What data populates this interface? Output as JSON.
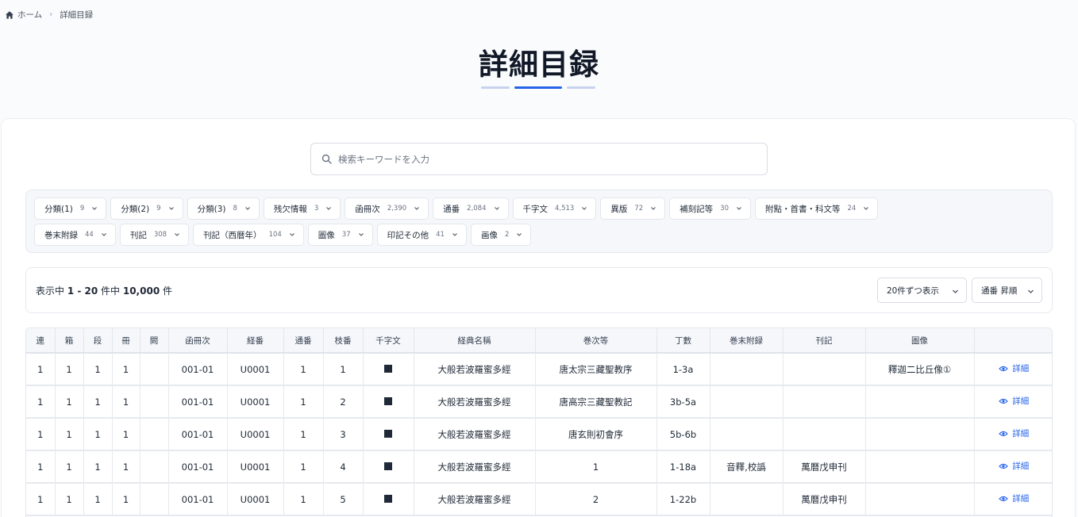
{
  "breadcrumb": {
    "home": "ホーム",
    "separator": "›",
    "current": "詳細目録"
  },
  "page_title": "詳細目録",
  "colors": {
    "accent": "#2563eb",
    "accent_light": "#c7d2ee"
  },
  "search": {
    "placeholder": "検索キーワードを入力",
    "value": ""
  },
  "filters": {
    "row1": [
      {
        "label": "分類(1)",
        "count": "9"
      },
      {
        "label": "分類(2)",
        "count": "9"
      },
      {
        "label": "分類(3)",
        "count": "8"
      },
      {
        "label": "残欠情報",
        "count": "3"
      },
      {
        "label": "函冊次",
        "count": "2,390"
      },
      {
        "label": "通番",
        "count": "2,084"
      },
      {
        "label": "千字文",
        "count": "4,513"
      },
      {
        "label": "異版",
        "count": "72"
      },
      {
        "label": "補刻記等",
        "count": "30"
      },
      {
        "label": "附點・首書・科文等",
        "count": "24"
      }
    ],
    "row2": [
      {
        "label": "巻末附録",
        "count": "44"
      },
      {
        "label": "刊記",
        "count": "308"
      },
      {
        "label": "刊記（西暦年）",
        "count": "104"
      },
      {
        "label": "圖像",
        "count": "37"
      },
      {
        "label": "印記その他",
        "count": "41"
      },
      {
        "label": "画像",
        "count": "2"
      }
    ]
  },
  "results": {
    "prefix": "表示中 ",
    "range": "1 - 20",
    "middle": " 件中 ",
    "total": "10,000",
    "suffix": " 件",
    "per_page": "20件ずつ表示",
    "sort": "通番 昇順"
  },
  "table": {
    "headers": [
      "連",
      "箱",
      "段",
      "冊",
      "闕",
      "函冊次",
      "経番",
      "通番",
      "枝番",
      "千字文",
      "経典名稱",
      "巻次等",
      "丁數",
      "巻末附録",
      "刊記",
      "圖像",
      ""
    ],
    "detail_label": "詳細",
    "rows": [
      {
        "ren": "1",
        "hako": "1",
        "dan": "1",
        "satsu": "1",
        "ketsu": "",
        "kansatsuji": "001-01",
        "kyoban": "U0001",
        "tsuban": "1",
        "edaban": "1",
        "title": "大般若波羅蜜多經",
        "kanji": "唐太宗三藏聖教序",
        "chosu": "1-3a",
        "kanmatsu": "",
        "kanki": "",
        "zuzo": "釋迦二比丘像①"
      },
      {
        "ren": "1",
        "hako": "1",
        "dan": "1",
        "satsu": "1",
        "ketsu": "",
        "kansatsuji": "001-01",
        "kyoban": "U0001",
        "tsuban": "1",
        "edaban": "2",
        "title": "大般若波羅蜜多經",
        "kanji": "唐高宗三藏聖教記",
        "chosu": "3b-5a",
        "kanmatsu": "",
        "kanki": "",
        "zuzo": ""
      },
      {
        "ren": "1",
        "hako": "1",
        "dan": "1",
        "satsu": "1",
        "ketsu": "",
        "kansatsuji": "001-01",
        "kyoban": "U0001",
        "tsuban": "1",
        "edaban": "3",
        "title": "大般若波羅蜜多經",
        "kanji": "唐玄則初會序",
        "chosu": "5b-6b",
        "kanmatsu": "",
        "kanki": "",
        "zuzo": ""
      },
      {
        "ren": "1",
        "hako": "1",
        "dan": "1",
        "satsu": "1",
        "ketsu": "",
        "kansatsuji": "001-01",
        "kyoban": "U0001",
        "tsuban": "1",
        "edaban": "4",
        "title": "大般若波羅蜜多經",
        "kanji": "1",
        "chosu": "1-18a",
        "kanmatsu": "音釋,校譌",
        "kanki": "萬曆戊申刊",
        "zuzo": ""
      },
      {
        "ren": "1",
        "hako": "1",
        "dan": "1",
        "satsu": "1",
        "ketsu": "",
        "kansatsuji": "001-01",
        "kyoban": "U0001",
        "tsuban": "1",
        "edaban": "5",
        "title": "大般若波羅蜜多經",
        "kanji": "2",
        "chosu": "1-22b",
        "kanmatsu": "",
        "kanki": "萬曆戊申刊",
        "zuzo": ""
      }
    ]
  }
}
